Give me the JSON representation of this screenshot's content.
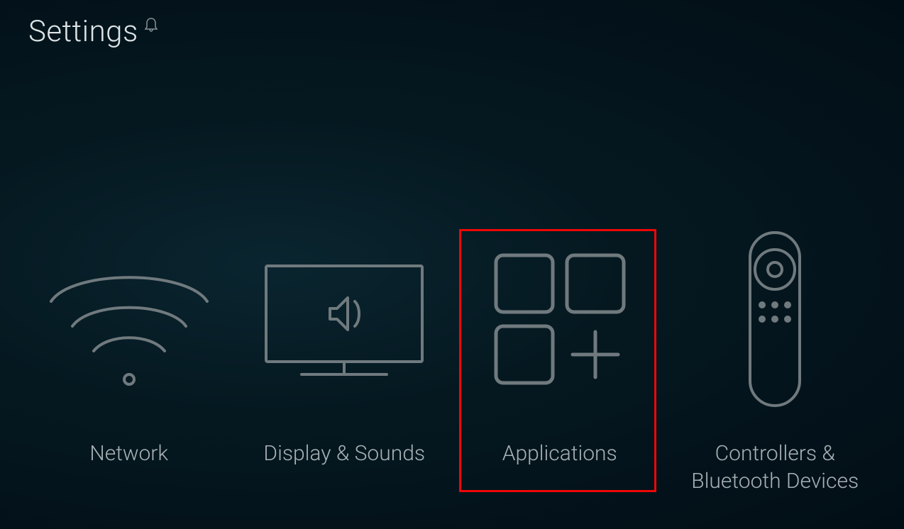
{
  "header": {
    "title": "Settings",
    "notification_icon": "bell-icon"
  },
  "tiles": [
    {
      "label": "Network",
      "icon": "wifi-icon"
    },
    {
      "label": "Display & Sounds",
      "icon": "display-sounds-icon"
    },
    {
      "label": "Applications",
      "icon": "applications-icon",
      "highlighted": true
    },
    {
      "label": "Controllers & Bluetooth Devices",
      "icon": "remote-icon"
    }
  ],
  "highlight": {
    "color": "#ef0606",
    "target": "Applications"
  }
}
